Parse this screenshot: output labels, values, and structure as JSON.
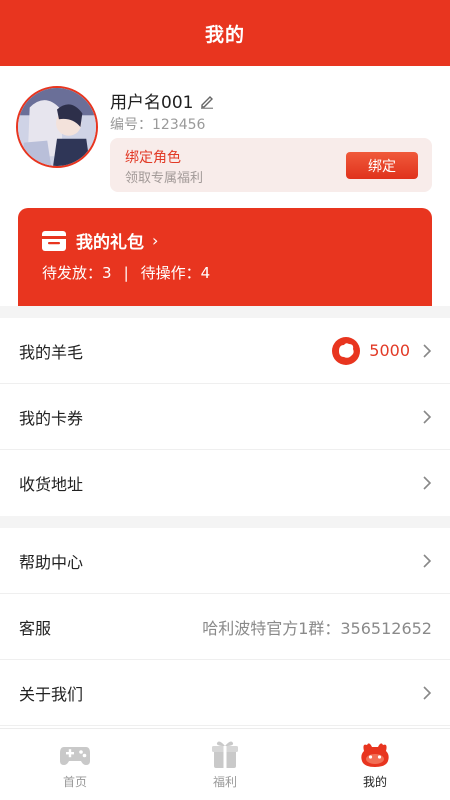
{
  "header": {
    "title": "我的"
  },
  "profile": {
    "username": "用户名001",
    "id_label": "编号：",
    "id_value": "123456",
    "bind_card": {
      "title": "绑定角色",
      "subtitle": "领取专属福利",
      "button_label": "绑定"
    }
  },
  "gift": {
    "title": "我的礼包",
    "pending_label": "待发放：",
    "pending_value": "3",
    "separator": "|",
    "action_label": "待操作：",
    "action_value": "4"
  },
  "menu": {
    "wool": {
      "label": "我的羊毛",
      "value": "5000",
      "icon": "coin-icon"
    },
    "coupons": {
      "label": "我的卡券"
    },
    "address": {
      "label": "收货地址"
    },
    "help": {
      "label": "帮助中心"
    },
    "service": {
      "label": "客服",
      "value": "哈利波特官方1群：356512652"
    },
    "about": {
      "label": "关于我们"
    }
  },
  "tabbar": {
    "tabs": [
      {
        "label": "首页",
        "icon": "gamepad-icon",
        "active": false
      },
      {
        "label": "福利",
        "icon": "gift-box-icon",
        "active": false
      },
      {
        "label": "我的",
        "icon": "mascot-icon",
        "active": true
      }
    ]
  },
  "colors": {
    "accent": "#e8351f",
    "background": "#f4f4f4"
  }
}
